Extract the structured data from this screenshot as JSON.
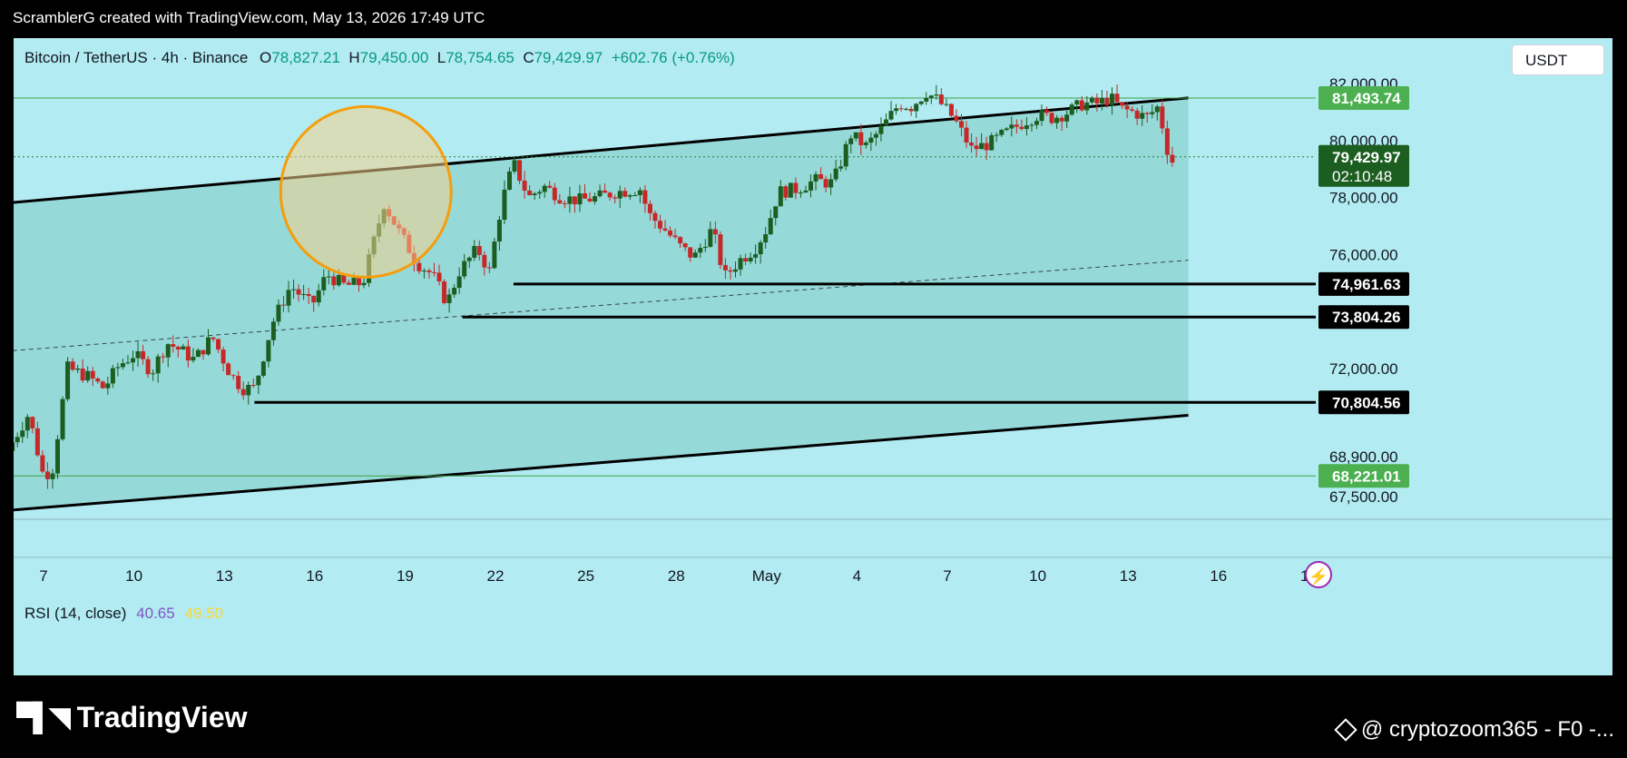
{
  "header": {
    "credit": "ScramblerG created with TradingView.com, May 13, 2026 17:49 UTC"
  },
  "legend": {
    "symbol": "Bitcoin / TetherUS · 4h · Binance",
    "o_label": "O",
    "o_value": "78,827.21",
    "h_label": "H",
    "h_value": "79,450.00",
    "l_label": "L",
    "l_value": "78,754.65",
    "c_label": "C",
    "c_value": "79,429.97",
    "change": "+602.76 (+0.76%)"
  },
  "unit_button": "USDT",
  "rsi": {
    "label": "RSI (14, close)",
    "value1": "40.65",
    "value2": "49.50"
  },
  "branding": {
    "logo_text": "TradingView",
    "watermark": "@ cryptozoom365 - F0 -..."
  },
  "colors": {
    "background": "#b2ebf2",
    "channel_fill": "#80cbc4",
    "up": "#1b5e20",
    "down": "#c62828",
    "line_green": "#43a047",
    "circle_stroke": "#f59e0b",
    "circle_fill": "#f6d08a"
  },
  "chart_data": {
    "type": "candlestick",
    "timeframe": "4h",
    "ylim": [
      66700,
      83600
    ],
    "y_ticks": [
      "82,000.00",
      "80,000.00",
      "78,000.00",
      "76,000.00",
      "72,000.00",
      "68,900.00",
      "67,500.00"
    ],
    "y_tick_values": [
      82000,
      80000,
      78000,
      76000,
      72000,
      68900,
      67500
    ],
    "x_ticks": [
      "7",
      "10",
      "13",
      "16",
      "19",
      "22",
      "25",
      "28",
      "May",
      "4",
      "7",
      "10",
      "13",
      "16",
      "19"
    ],
    "x_tick_days": [
      0,
      3,
      6,
      9,
      12,
      15,
      18,
      21,
      24,
      27,
      30,
      33,
      36,
      39,
      42
    ],
    "close_path": [
      [
        -1.2,
        69100
      ],
      [
        -0.5,
        70400
      ],
      [
        0.0,
        68200
      ],
      [
        0.3,
        68500
      ],
      [
        0.8,
        72000
      ],
      [
        1.5,
        71700
      ],
      [
        2.0,
        71300
      ],
      [
        2.5,
        72100
      ],
      [
        3.0,
        72500
      ],
      [
        3.6,
        71900
      ],
      [
        4.1,
        72900
      ],
      [
        4.6,
        72600
      ],
      [
        5.0,
        72300
      ],
      [
        5.6,
        73100
      ],
      [
        6.2,
        71800
      ],
      [
        6.6,
        71300
      ],
      [
        7.0,
        71300
      ],
      [
        7.6,
        73600
      ],
      [
        8.2,
        74900
      ],
      [
        8.9,
        74200
      ],
      [
        9.4,
        75300
      ],
      [
        10.0,
        74900
      ],
      [
        10.6,
        75000
      ],
      [
        11.3,
        77800
      ],
      [
        11.8,
        76800
      ],
      [
        12.4,
        75700
      ],
      [
        12.9,
        75300
      ],
      [
        13.4,
        74300
      ],
      [
        13.8,
        75400
      ],
      [
        14.4,
        76200
      ],
      [
        14.8,
        75400
      ],
      [
        15.2,
        77800
      ],
      [
        15.6,
        79200
      ],
      [
        16.1,
        78000
      ],
      [
        16.6,
        78400
      ],
      [
        17.2,
        78000
      ],
      [
        17.8,
        77900
      ],
      [
        18.4,
        78000
      ],
      [
        19.0,
        78200
      ],
      [
        19.8,
        78300
      ],
      [
        20.1,
        77400
      ],
      [
        20.6,
        76900
      ],
      [
        21.2,
        76200
      ],
      [
        21.6,
        75900
      ],
      [
        22.2,
        76900
      ],
      [
        22.6,
        75200
      ],
      [
        23.1,
        75800
      ],
      [
        23.6,
        76200
      ],
      [
        24.0,
        76900
      ],
      [
        24.4,
        78200
      ],
      [
        25.0,
        78300
      ],
      [
        25.6,
        78600
      ],
      [
        26.2,
        78500
      ],
      [
        26.8,
        80200
      ],
      [
        27.3,
        79800
      ],
      [
        27.8,
        80400
      ],
      [
        28.4,
        81300
      ],
      [
        28.8,
        81200
      ],
      [
        29.3,
        81700
      ],
      [
        29.7,
        81400
      ],
      [
        30.2,
        80800
      ],
      [
        30.8,
        79700
      ],
      [
        31.4,
        79900
      ],
      [
        32.0,
        80300
      ],
      [
        32.6,
        80700
      ],
      [
        33.0,
        80900
      ],
      [
        33.5,
        80800
      ],
      [
        34.0,
        81000
      ],
      [
        34.5,
        81300
      ],
      [
        35.0,
        81300
      ],
      [
        35.4,
        81500
      ],
      [
        35.8,
        81100
      ],
      [
        36.2,
        81000
      ],
      [
        36.6,
        80800
      ],
      [
        37.0,
        81200
      ],
      [
        37.4,
        79200
      ],
      [
        37.6,
        79430
      ]
    ],
    "current_price": {
      "value": 79429.97,
      "label": "79,429.97",
      "countdown": "02:10:48"
    },
    "horizontal_levels": [
      {
        "value": 81493.74,
        "label": "81,493.74",
        "style": "green"
      },
      {
        "value": 74961.63,
        "label": "74,961.63",
        "style": "black",
        "start_day": 15.6
      },
      {
        "value": 73804.26,
        "label": "73,804.26",
        "style": "black",
        "start_day": 13.9
      },
      {
        "value": 70804.56,
        "label": "70,804.56",
        "style": "black",
        "start_day": 7.0
      },
      {
        "value": 68221.01,
        "label": "68,221.01",
        "style": "green"
      }
    ],
    "channel": {
      "upper": [
        [
          -1.3,
          77800
        ],
        [
          38.0,
          81500
        ]
      ],
      "lower": [
        [
          -1.3,
          67000
        ],
        [
          38.0,
          70350
        ]
      ],
      "mid_dashed": [
        [
          -1.3,
          72600
        ],
        [
          38.0,
          75800
        ]
      ]
    },
    "highlight_circle": {
      "day": 10.7,
      "price": 78200,
      "note": "orange circle marking rejection at channel top"
    }
  }
}
